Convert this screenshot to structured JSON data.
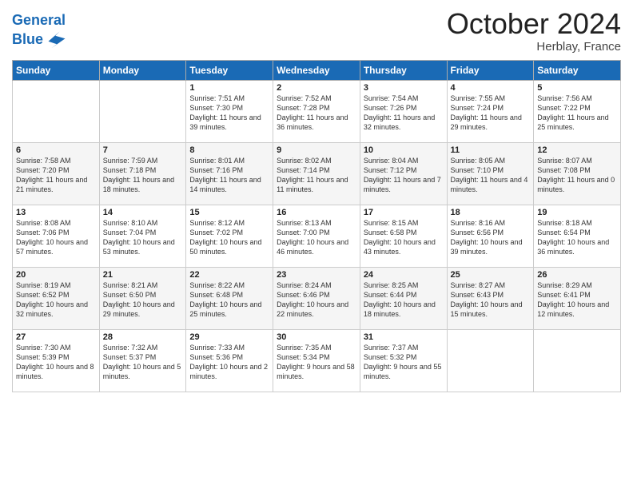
{
  "header": {
    "logo_line1": "General",
    "logo_line2": "Blue",
    "month": "October 2024",
    "location": "Herblay, France"
  },
  "days_of_week": [
    "Sunday",
    "Monday",
    "Tuesday",
    "Wednesday",
    "Thursday",
    "Friday",
    "Saturday"
  ],
  "weeks": [
    [
      {
        "day": "",
        "info": ""
      },
      {
        "day": "",
        "info": ""
      },
      {
        "day": "1",
        "info": "Sunrise: 7:51 AM\nSunset: 7:30 PM\nDaylight: 11 hours and 39 minutes."
      },
      {
        "day": "2",
        "info": "Sunrise: 7:52 AM\nSunset: 7:28 PM\nDaylight: 11 hours and 36 minutes."
      },
      {
        "day": "3",
        "info": "Sunrise: 7:54 AM\nSunset: 7:26 PM\nDaylight: 11 hours and 32 minutes."
      },
      {
        "day": "4",
        "info": "Sunrise: 7:55 AM\nSunset: 7:24 PM\nDaylight: 11 hours and 29 minutes."
      },
      {
        "day": "5",
        "info": "Sunrise: 7:56 AM\nSunset: 7:22 PM\nDaylight: 11 hours and 25 minutes."
      }
    ],
    [
      {
        "day": "6",
        "info": "Sunrise: 7:58 AM\nSunset: 7:20 PM\nDaylight: 11 hours and 21 minutes."
      },
      {
        "day": "7",
        "info": "Sunrise: 7:59 AM\nSunset: 7:18 PM\nDaylight: 11 hours and 18 minutes."
      },
      {
        "day": "8",
        "info": "Sunrise: 8:01 AM\nSunset: 7:16 PM\nDaylight: 11 hours and 14 minutes."
      },
      {
        "day": "9",
        "info": "Sunrise: 8:02 AM\nSunset: 7:14 PM\nDaylight: 11 hours and 11 minutes."
      },
      {
        "day": "10",
        "info": "Sunrise: 8:04 AM\nSunset: 7:12 PM\nDaylight: 11 hours and 7 minutes."
      },
      {
        "day": "11",
        "info": "Sunrise: 8:05 AM\nSunset: 7:10 PM\nDaylight: 11 hours and 4 minutes."
      },
      {
        "day": "12",
        "info": "Sunrise: 8:07 AM\nSunset: 7:08 PM\nDaylight: 11 hours and 0 minutes."
      }
    ],
    [
      {
        "day": "13",
        "info": "Sunrise: 8:08 AM\nSunset: 7:06 PM\nDaylight: 10 hours and 57 minutes."
      },
      {
        "day": "14",
        "info": "Sunrise: 8:10 AM\nSunset: 7:04 PM\nDaylight: 10 hours and 53 minutes."
      },
      {
        "day": "15",
        "info": "Sunrise: 8:12 AM\nSunset: 7:02 PM\nDaylight: 10 hours and 50 minutes."
      },
      {
        "day": "16",
        "info": "Sunrise: 8:13 AM\nSunset: 7:00 PM\nDaylight: 10 hours and 46 minutes."
      },
      {
        "day": "17",
        "info": "Sunrise: 8:15 AM\nSunset: 6:58 PM\nDaylight: 10 hours and 43 minutes."
      },
      {
        "day": "18",
        "info": "Sunrise: 8:16 AM\nSunset: 6:56 PM\nDaylight: 10 hours and 39 minutes."
      },
      {
        "day": "19",
        "info": "Sunrise: 8:18 AM\nSunset: 6:54 PM\nDaylight: 10 hours and 36 minutes."
      }
    ],
    [
      {
        "day": "20",
        "info": "Sunrise: 8:19 AM\nSunset: 6:52 PM\nDaylight: 10 hours and 32 minutes."
      },
      {
        "day": "21",
        "info": "Sunrise: 8:21 AM\nSunset: 6:50 PM\nDaylight: 10 hours and 29 minutes."
      },
      {
        "day": "22",
        "info": "Sunrise: 8:22 AM\nSunset: 6:48 PM\nDaylight: 10 hours and 25 minutes."
      },
      {
        "day": "23",
        "info": "Sunrise: 8:24 AM\nSunset: 6:46 PM\nDaylight: 10 hours and 22 minutes."
      },
      {
        "day": "24",
        "info": "Sunrise: 8:25 AM\nSunset: 6:44 PM\nDaylight: 10 hours and 18 minutes."
      },
      {
        "day": "25",
        "info": "Sunrise: 8:27 AM\nSunset: 6:43 PM\nDaylight: 10 hours and 15 minutes."
      },
      {
        "day": "26",
        "info": "Sunrise: 8:29 AM\nSunset: 6:41 PM\nDaylight: 10 hours and 12 minutes."
      }
    ],
    [
      {
        "day": "27",
        "info": "Sunrise: 7:30 AM\nSunset: 5:39 PM\nDaylight: 10 hours and 8 minutes."
      },
      {
        "day": "28",
        "info": "Sunrise: 7:32 AM\nSunset: 5:37 PM\nDaylight: 10 hours and 5 minutes."
      },
      {
        "day": "29",
        "info": "Sunrise: 7:33 AM\nSunset: 5:36 PM\nDaylight: 10 hours and 2 minutes."
      },
      {
        "day": "30",
        "info": "Sunrise: 7:35 AM\nSunset: 5:34 PM\nDaylight: 9 hours and 58 minutes."
      },
      {
        "day": "31",
        "info": "Sunrise: 7:37 AM\nSunset: 5:32 PM\nDaylight: 9 hours and 55 minutes."
      },
      {
        "day": "",
        "info": ""
      },
      {
        "day": "",
        "info": ""
      }
    ]
  ]
}
